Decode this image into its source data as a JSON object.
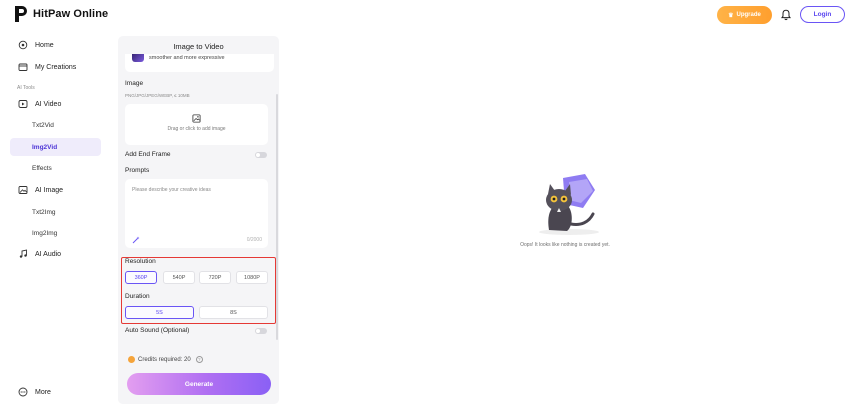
{
  "header": {
    "logo_text": "HitPaw Online",
    "upgrade_label": "Upgrade",
    "login_label": "Login"
  },
  "sidebar": {
    "home": "Home",
    "my_creations": "My Creations",
    "section_label": "AI Tools",
    "ai_video": "AI Video",
    "txt2vid": "Txt2Vid",
    "img2vid": "Img2Vid",
    "effects": "Effects",
    "ai_image": "AI Image",
    "txt2img": "Txt2Img",
    "img2img": "Img2Img",
    "ai_audio": "AI Audio",
    "more": "More"
  },
  "panel": {
    "title": "Image to Video",
    "card_desc": "smoother and more expressive",
    "image_label": "Image",
    "image_formats": "PNG/JPG/JPEG/WEBP, ≤ 10MB",
    "drop_text": "Drag or click to add image",
    "end_frame_label": "Add End Frame",
    "prompts_label": "Prompts",
    "prompt_placeholder": "Please describe your creative ideas",
    "prompt_counter": "0/2000",
    "resolution_label": "Resolution",
    "resolutions": [
      "360P",
      "540P",
      "720P",
      "1080P"
    ],
    "selected_resolution": "360P",
    "duration_label": "Duration",
    "durations": [
      "5S",
      "8S"
    ],
    "selected_duration": "5S",
    "auto_sound_label": "Auto Sound (Optional)",
    "credits_text": "Credits required: 20",
    "generate_label": "Generate"
  },
  "canvas": {
    "empty_text": "Oops! It looks like nothing is created yet."
  },
  "colors": {
    "accent": "#6a55f5",
    "upgrade": "#ffa93d",
    "highlight": "#e53935",
    "active_bg": "#efecfb"
  }
}
